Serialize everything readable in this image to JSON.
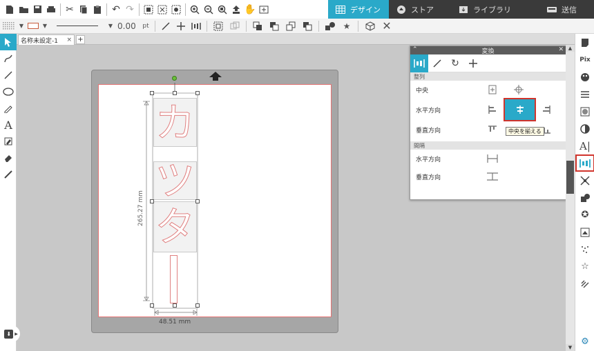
{
  "toolbar": {
    "icons": [
      "new-icon",
      "open-icon",
      "save-icon",
      "print-icon",
      "cut-icon",
      "copy-icon",
      "paste-icon",
      "undo-icon",
      "redo-icon",
      "select-all-icon",
      "deselect-icon",
      "edit-points-icon",
      "zoom-in-icon",
      "zoom-out-icon",
      "zoom-fit-icon",
      "pan-down-icon",
      "hand-icon",
      "fit-page-icon"
    ]
  },
  "tabs": [
    {
      "label": "デザイン",
      "icon": "grid-icon",
      "active": true
    },
    {
      "label": "ストア",
      "icon": "store-icon",
      "active": false
    },
    {
      "label": "ライブラリ",
      "icon": "library-icon",
      "active": false
    },
    {
      "label": "送信",
      "icon": "send-icon",
      "active": false
    }
  ],
  "secondary": {
    "line_width_value": "0.00",
    "line_width_unit": "pt"
  },
  "document": {
    "tab_label": "名称未設定-1",
    "close": "×",
    "add": "+"
  },
  "canvas": {
    "glyphs": [
      "カ",
      "ツ",
      "タ",
      "ー"
    ],
    "height_dim": "265.27 mm",
    "width_dim": "48.51 mm"
  },
  "panel": {
    "title": "変換",
    "align_section": "整列",
    "rows": {
      "center": "中央",
      "horizontal": "水平方向",
      "vertical": "垂直方向"
    },
    "spacing_section": "間隔",
    "spacing_rows": {
      "horizontal": "水平方向",
      "vertical": "垂直方向"
    },
    "tooltip": "中央を揃える"
  },
  "colors": {
    "accent": "#2aa9c9",
    "highlight_border": "#d0342c",
    "tab_bar": "#3a3a3a"
  }
}
